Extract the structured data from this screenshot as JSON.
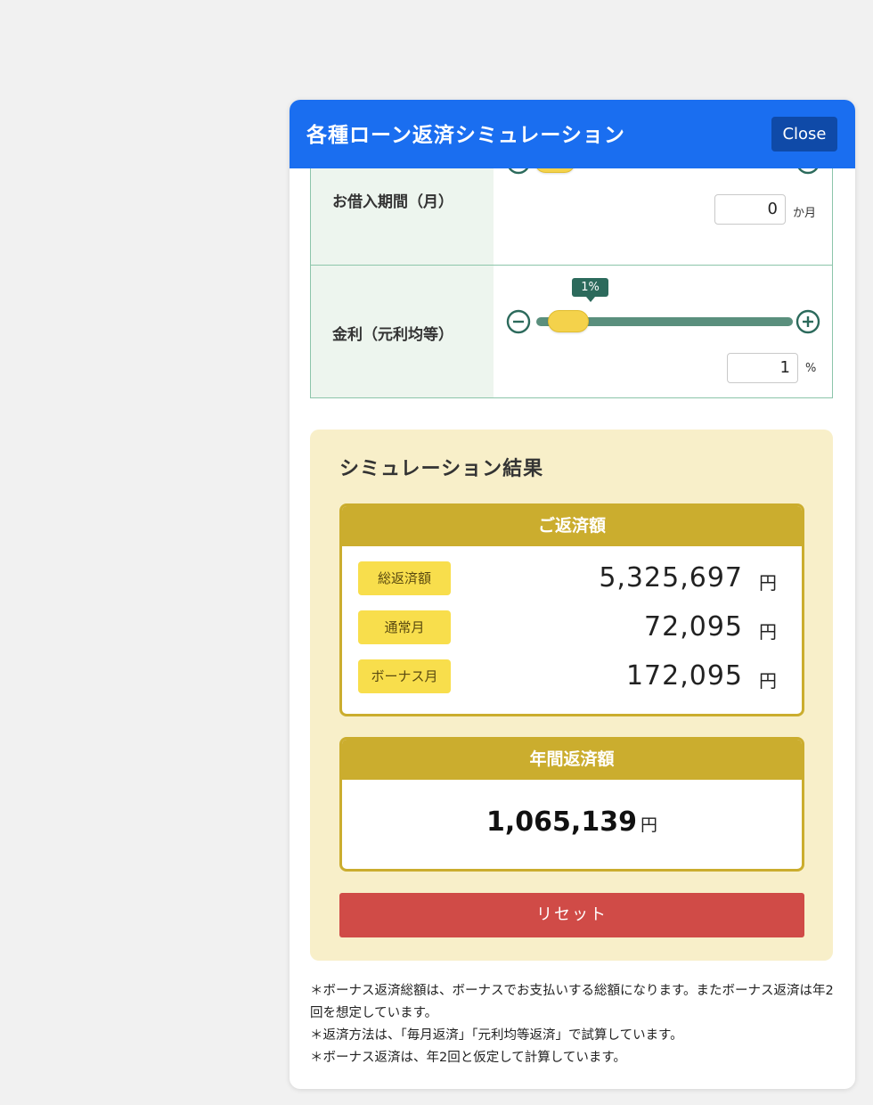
{
  "header": {
    "title": "各種ローン返済シミュレーション",
    "close_label": "Close"
  },
  "form": {
    "term": {
      "label": "お借入期間（月）",
      "value": "0",
      "unit": "か月",
      "slider_fraction": 0.0
    },
    "rate": {
      "label": "金利（元利均等）",
      "value": "1",
      "unit": "%",
      "tooltip": "1%",
      "slider_fraction": 0.06
    },
    "minus_icon": "minus-circle-icon",
    "plus_icon": "plus-circle-icon",
    "accent_color": "#5a8f7d"
  },
  "result": {
    "title": "シミュレーション結果",
    "repayment": {
      "heading": "ご返済額",
      "rows": [
        {
          "label": "総返済額",
          "amount": "5,325,697",
          "unit": "円"
        },
        {
          "label": "通常月",
          "amount": "72,095",
          "unit": "円"
        },
        {
          "label": "ボーナス月",
          "amount": "172,095",
          "unit": "円"
        }
      ]
    },
    "annual": {
      "heading": "年間返済額",
      "amount": "1,065,139",
      "unit": "円"
    },
    "reset_label": "リセット"
  },
  "notes": [
    "＊ボーナス返済総額は、ボーナスでお支払いする総額になります。またボーナス返済は年2回を想定しています。",
    "＊返済方法は、「毎月返済」「元利均等返済」で試算しています。",
    "＊ボーナス返済は、年2回と仮定して計算しています。"
  ],
  "colors": {
    "header_bg": "#1a6ef0",
    "gold": "#cbad2e",
    "reset": "#d04b47",
    "badge": "#f8de4c"
  }
}
